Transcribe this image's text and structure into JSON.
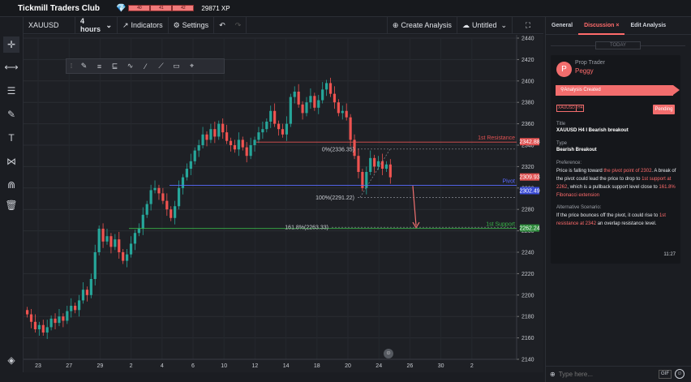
{
  "app": {
    "title": "Tickmill Traders Club",
    "xp_levels": [
      "40",
      "41",
      "42"
    ],
    "xp": "29871 XP"
  },
  "toolbar": {
    "symbol": "XAUUSD",
    "interval": "4 hours",
    "indicators": "Indicators",
    "settings": "Settings",
    "create_analysis": "Create Analysis",
    "untitled": "Untitled"
  },
  "chart_data": {
    "type": "candlestick",
    "symbol": "XAUUSD",
    "interval": "4 hours",
    "y_ticks": [
      2440,
      2420,
      2400,
      2380,
      2360,
      2340,
      2320,
      2300,
      2280,
      2260,
      2240,
      2220,
      2200,
      2180,
      2160,
      2140
    ],
    "ylim": [
      2140,
      2440
    ],
    "x_ticks": [
      "23",
      "27",
      "29",
      "2",
      "4",
      "6",
      "10",
      "12",
      "14",
      "18",
      "20",
      "24",
      "26",
      "30",
      "2"
    ],
    "levels": [
      {
        "name": "1st Resistance",
        "price": 2342.88,
        "color": "#e05252"
      },
      {
        "name": "Pivot",
        "price": 2302.49,
        "color": "#5a6bff"
      },
      {
        "name": "1st Support",
        "price": 2262.24,
        "color": "#39b54a"
      }
    ],
    "price_tags": [
      {
        "label": "2342.88",
        "color": "#e05252"
      },
      {
        "label": "2309.93",
        "color": "#e05252"
      },
      {
        "label": "2302.49",
        "color": "#3a4bd6"
      },
      {
        "label": "2262.24",
        "color": "#2e8b3c"
      }
    ],
    "fib": [
      {
        "label": "0%(2336.35)",
        "price": 2336.35
      },
      {
        "label": "100%(2291.22)",
        "price": 2291.22
      },
      {
        "label": "161.8%(2263.33)",
        "price": 2263.33
      }
    ],
    "closes": [
      2182,
      2175,
      2168,
      2172,
      2165,
      2170,
      2178,
      2174,
      2180,
      2176,
      2185,
      2190,
      2186,
      2195,
      2205,
      2200,
      2215,
      2240,
      2262,
      2250,
      2255,
      2245,
      2252,
      2240,
      2232,
      2238,
      2248,
      2258,
      2262,
      2275,
      2285,
      2298,
      2300,
      2295,
      2288,
      2280,
      2272,
      2283,
      2300,
      2310,
      2318,
      2325,
      2335,
      2340,
      2350,
      2345,
      2355,
      2348,
      2360,
      2352,
      2344,
      2340,
      2336,
      2345,
      2338,
      2330,
      2340,
      2345,
      2352,
      2355,
      2362,
      2372,
      2360,
      2355,
      2350,
      2360,
      2385,
      2390,
      2378,
      2370,
      2380,
      2386,
      2375,
      2382,
      2392,
      2398,
      2388,
      2380,
      2370,
      2372,
      2366,
      2345,
      2330,
      2315,
      2300,
      2315,
      2328,
      2320,
      2325,
      2318,
      2322,
      2310
    ]
  },
  "discussion": {
    "tabs": [
      "General",
      "Discussion",
      "Edit Analysis"
    ],
    "close_glyph": "×",
    "today": "TODAY",
    "role": "Prop Trader",
    "user": "Peggy",
    "avatar_letter": "P",
    "created": "Analysis Created",
    "tag_symbol": "XAUUSD",
    "tag_interval": "H4",
    "status": "Pending",
    "title_label": "Title",
    "title_value": "XAUUSD H4 I Bearish breakout",
    "type_label": "Type",
    "type_value": "Bearish Breakout",
    "preference_label": "Preference:",
    "pref_1": "Price is falling toward ",
    "pref_hl1": "the pivot point of 2302",
    "pref_2": ". A break of the pivot could lead the price to drop to ",
    "pref_hl2": "1st support at 2262",
    "pref_3": ",  which is a pullback support level close to ",
    "pref_hl3": "161.8% Fibonacci extension",
    "alt_label": "Alternative Scenario:",
    "alt_1": "If the price bounces off the pivot, it could rise to ",
    "alt_hl1": "1st resistance at 2342",
    "alt_2": " an overlap resistance level.",
    "time": "11:27",
    "input_placeholder": "Type here...",
    "gif": "GIF"
  }
}
